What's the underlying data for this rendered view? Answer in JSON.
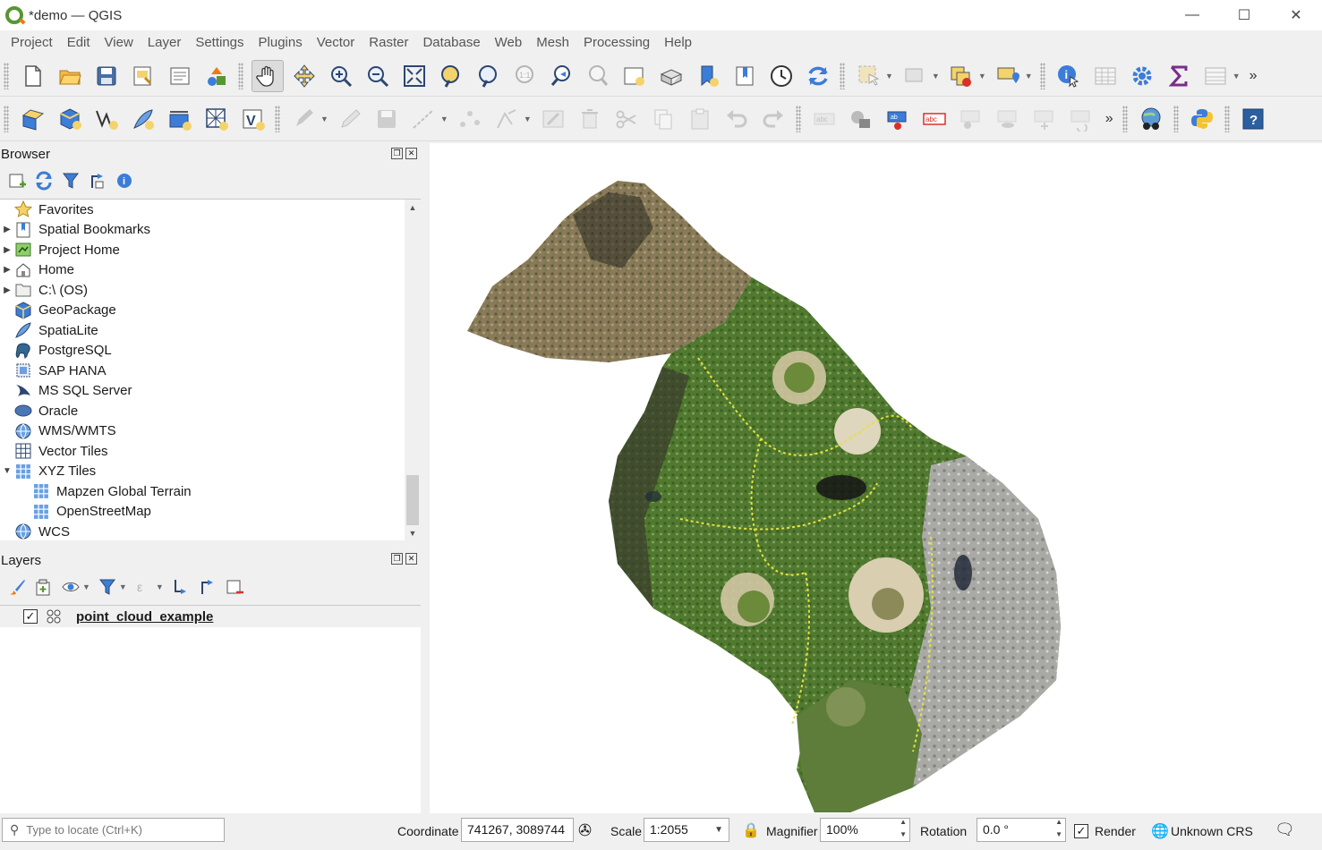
{
  "window": {
    "title": "*demo — QGIS"
  },
  "menu": [
    "Project",
    "Edit",
    "View",
    "Layer",
    "Settings",
    "Plugins",
    "Vector",
    "Raster",
    "Database",
    "Web",
    "Mesh",
    "Processing",
    "Help"
  ],
  "browser": {
    "title": "Browser",
    "items": [
      {
        "label": "Favorites",
        "icon": "star-icon",
        "arrow": "",
        "indent": 0
      },
      {
        "label": "Spatial Bookmarks",
        "icon": "bookmark-icon",
        "arrow": "▶",
        "indent": 0
      },
      {
        "label": "Project Home",
        "icon": "project-home-icon",
        "arrow": "▶",
        "indent": 0
      },
      {
        "label": "Home",
        "icon": "home-icon",
        "arrow": "▶",
        "indent": 0
      },
      {
        "label": "C:\\ (OS)",
        "icon": "folder-icon",
        "arrow": "▶",
        "indent": 0
      },
      {
        "label": "GeoPackage",
        "icon": "geopackage-icon",
        "arrow": "",
        "indent": 0
      },
      {
        "label": "SpatiaLite",
        "icon": "spatialite-icon",
        "arrow": "",
        "indent": 0
      },
      {
        "label": "PostgreSQL",
        "icon": "postgresql-icon",
        "arrow": "",
        "indent": 0
      },
      {
        "label": "SAP HANA",
        "icon": "sap-hana-icon",
        "arrow": "",
        "indent": 0
      },
      {
        "label": "MS SQL Server",
        "icon": "mssql-icon",
        "arrow": "",
        "indent": 0
      },
      {
        "label": "Oracle",
        "icon": "oracle-icon",
        "arrow": "",
        "indent": 0
      },
      {
        "label": "WMS/WMTS",
        "icon": "wms-icon",
        "arrow": "",
        "indent": 0
      },
      {
        "label": "Vector Tiles",
        "icon": "vector-tiles-icon",
        "arrow": "",
        "indent": 0
      },
      {
        "label": "XYZ Tiles",
        "icon": "xyz-tiles-icon",
        "arrow": "▼",
        "indent": 0
      },
      {
        "label": "Mapzen Global Terrain",
        "icon": "xyz-tiles-icon",
        "arrow": "",
        "indent": 1
      },
      {
        "label": "OpenStreetMap",
        "icon": "xyz-tiles-icon",
        "arrow": "",
        "indent": 1
      },
      {
        "label": "WCS",
        "icon": "wcs-icon",
        "arrow": "",
        "indent": 0
      }
    ]
  },
  "layers": {
    "title": "Layers",
    "items": [
      {
        "label": "point_cloud_example",
        "checked": "✓",
        "icon": "point-cloud-icon"
      }
    ]
  },
  "status": {
    "locator_placeholder": "Type to locate (Ctrl+K)",
    "coordinate_label": "Coordinate",
    "coordinate_value": "741267, 3089744",
    "scale_label": "Scale",
    "scale_value": "1:2055",
    "magnifier_label": "Magnifier",
    "magnifier_value": "100%",
    "rotation_label": "Rotation",
    "rotation_value": "0.0 °",
    "render_label": "Render",
    "render_checked": "✓",
    "crs_label": "Unknown CRS"
  },
  "colors": {
    "accent": "#589632",
    "qgis_orange": "#ee7913",
    "map_bg": "#ffffff"
  }
}
